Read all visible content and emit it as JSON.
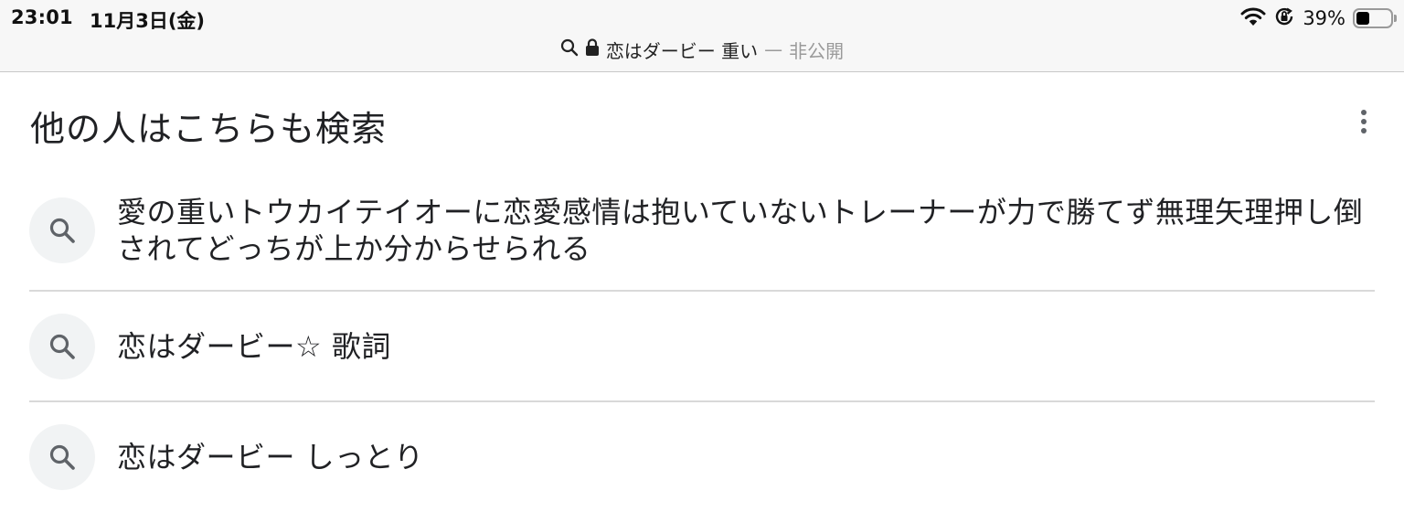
{
  "status_bar": {
    "time": "23:01",
    "date": "11月3日(金)",
    "battery_percent_label": "39%",
    "battery_level": 0.39,
    "icons": [
      "wifi-icon",
      "orientation-lock-icon",
      "battery-icon"
    ]
  },
  "address_bar": {
    "query": "恋はダービー 重い",
    "separator": "—",
    "private_label": "非公開",
    "icons": [
      "search-icon",
      "lock-icon"
    ]
  },
  "section": {
    "title": "他の人はこちらも検索",
    "more_icon": "more-vert-icon"
  },
  "suggestions": [
    {
      "text": "愛の重いトウカイテイオーに恋愛感情は抱いていないトレーナーが力で勝てず無理矢理押し倒されてどっちが上か分からせられる"
    },
    {
      "text": "恋はダービー☆ 歌詞"
    },
    {
      "text": "恋はダービー しっとり"
    }
  ],
  "colors": {
    "topbar_bg": "#f7f7f7",
    "icon_bg": "#f1f3f4",
    "text": "#202124",
    "muted": "#9a9a9a",
    "divider": "#d9d9d9"
  }
}
